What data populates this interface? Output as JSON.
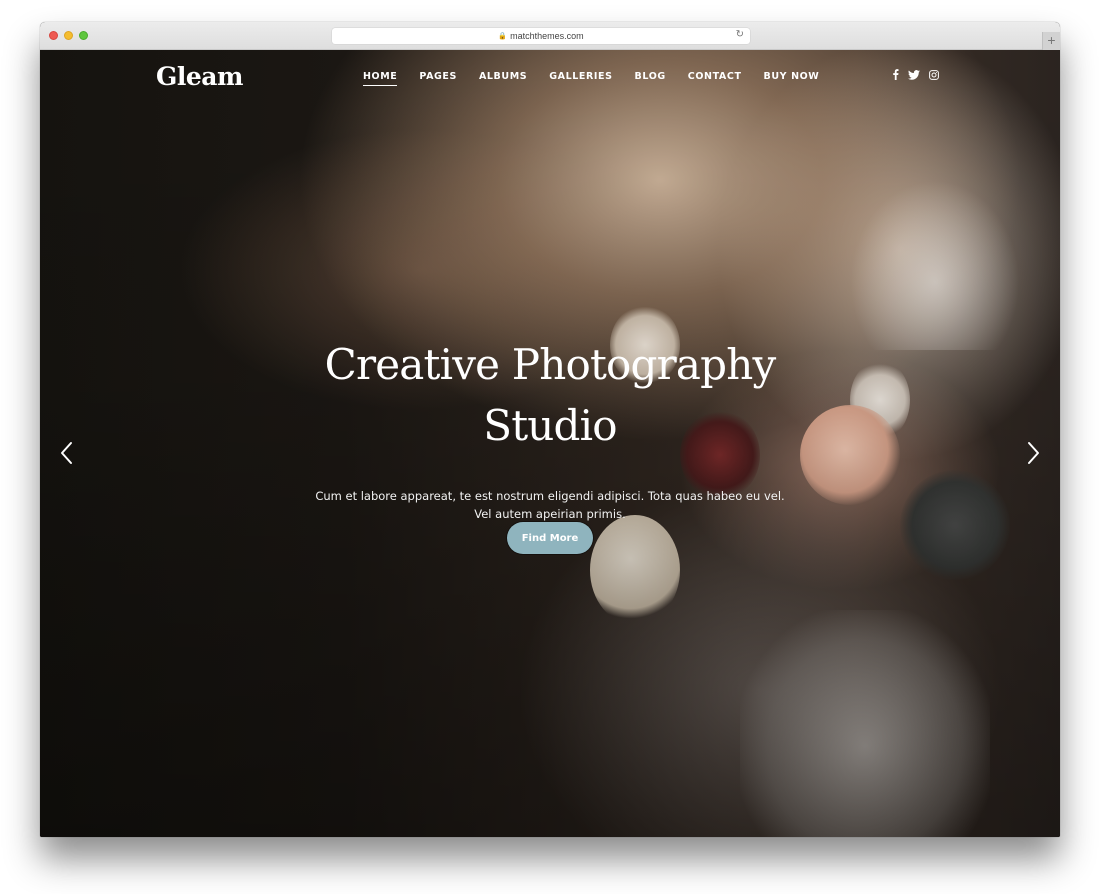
{
  "browser": {
    "url": "matchthemes.com",
    "lock_icon": "lock-icon",
    "reload_icon": "reload-icon",
    "new_tab_icon": "plus-icon",
    "new_tab_glyph": "+"
  },
  "site": {
    "logo": "Gleam",
    "nav": [
      {
        "label": "HOME",
        "active": true
      },
      {
        "label": "PAGES",
        "active": false
      },
      {
        "label": "ALBUMS",
        "active": false
      },
      {
        "label": "GALLERIES",
        "active": false
      },
      {
        "label": "BLOG",
        "active": false
      },
      {
        "label": "CONTACT",
        "active": false
      },
      {
        "label": "BUY NOW",
        "active": false
      }
    ],
    "social": [
      "facebook-icon",
      "twitter-icon",
      "instagram-icon"
    ]
  },
  "hero": {
    "headline_line1": "Creative Photography",
    "headline_line2": "Studio",
    "subtitle": "Cum et labore appareat, te est nostrum eligendi adipisci. Tota quas habeo eu vel. Vel autem apeirian primis.",
    "cta_label": "Find More",
    "prev_icon": "chevron-left-icon",
    "next_icon": "chevron-right-icon"
  },
  "colors": {
    "cta_background": "#8fb4be",
    "text": "#ffffff"
  }
}
